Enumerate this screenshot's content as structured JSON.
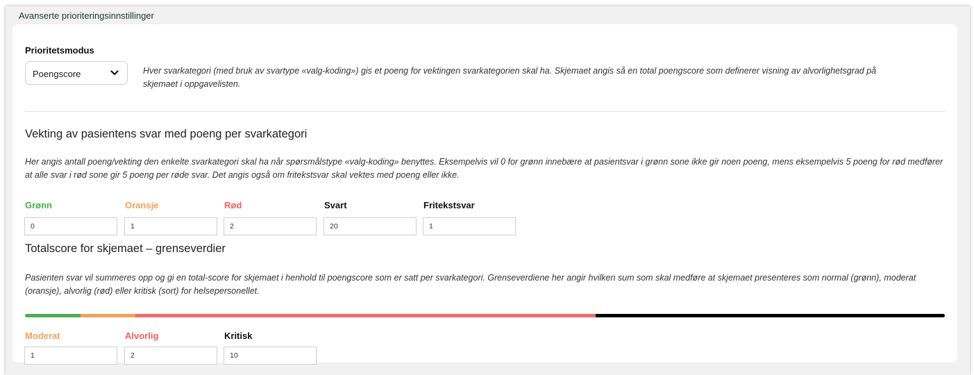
{
  "panel": {
    "title": "Avanserte prioriteringsinnstillinger"
  },
  "priority_mode": {
    "label": "Prioritetsmodus",
    "selected": "Poengscore",
    "description": "Hver svarkategori (med bruk av svartype «valg-koding») gis et poeng for vektingen svarkategorien skal ha. Skjemaet angis så en total poengscore som definerer visning av alvorlighetsgrad på skjemaet i oppgavelisten."
  },
  "weighting": {
    "heading": "Vekting av pasientens svar med poeng per svarkategori",
    "description": "Her angis antall poeng/vekting den enkelte svarkategori skal ha når spørsmålstype «valg-koding» benyttes. Eksempelvis vil 0 for grønn innebære at pasientsvar i grønn sone ikke gir noen poeng, mens eksempelvis 5 poeng for rød medfører at alle svar i rød sone gir 5 poeng per røde svar. Det angis også om fritekstsvar skal vektes med poeng eller ikke.",
    "fields": [
      {
        "label": "Grønn",
        "value": "0",
        "color": "#4caf50"
      },
      {
        "label": "Oransje",
        "value": "1",
        "color": "#f5a05a"
      },
      {
        "label": "Rød",
        "value": "2",
        "color": "#f25f5f"
      },
      {
        "label": "Svart",
        "value": "20",
        "color": "#111111"
      },
      {
        "label": "Fritekstsvar",
        "value": "1",
        "color": "#111111"
      }
    ]
  },
  "thresholds": {
    "heading": "Totalscore for skjemaet – grenseverdier",
    "description": "Pasienten svar vil summeres opp og gi en total-score for skjemaet i henhold til poengscore som er satt per svarkategori. Grenseverdiene her angir hvilken sum som skal medføre at skjemaet presenteres som normal (grønn), moderat (oransje), alvorlig (rød) eller kritisk (sort) for helsepersonellet.",
    "scale": {
      "colors": [
        "#4caf50",
        "#f5a05a",
        "#f06b6b",
        "#000000"
      ]
    },
    "fields": [
      {
        "label": "Moderat",
        "value": "1",
        "color": "#f5a05a"
      },
      {
        "label": "Alvorlig",
        "value": "2",
        "color": "#f25f5f"
      },
      {
        "label": "Kritisk",
        "value": "10",
        "color": "#111111"
      }
    ]
  }
}
